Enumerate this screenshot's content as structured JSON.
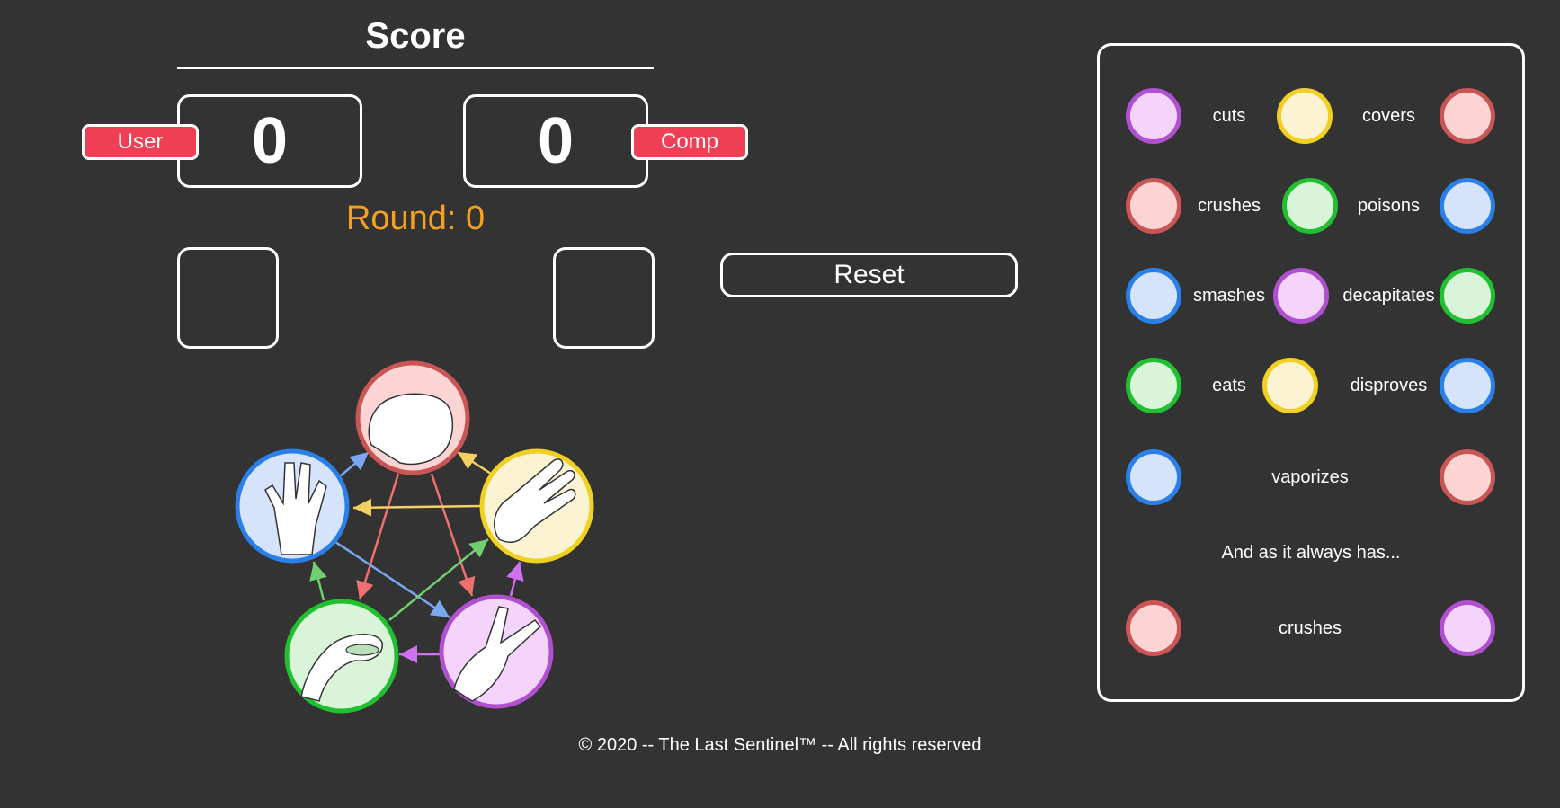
{
  "score": {
    "title": "Score",
    "user_value": "0",
    "comp_value": "0",
    "user_label": "User",
    "comp_label": "Comp",
    "round_text": "Round: 0"
  },
  "controls": {
    "reset_label": "Reset"
  },
  "colors": {
    "background": "#333333",
    "tag": "#ee3f55",
    "round": "#f5a020",
    "rock": "#c95555",
    "paper": "#f0d020",
    "scissors": "#b050d0",
    "lizard": "#20c030",
    "spock": "#2a7fe8"
  },
  "rules": [
    {
      "left": "scissors",
      "verb1": "cuts",
      "middle": "paper",
      "verb2": "covers",
      "right": "rock"
    },
    {
      "left": "rock",
      "verb1": "crushes",
      "middle": "lizard",
      "verb2": "poisons",
      "right": "spock"
    },
    {
      "left": "spock",
      "verb1": "smashes",
      "middle": "scissors",
      "verb2": "decapitates",
      "right": "lizard"
    },
    {
      "left": "lizard",
      "verb1": "eats",
      "middle": "paper",
      "verb2": "disproves",
      "right": "spock"
    }
  ],
  "rule5": {
    "left": "spock",
    "verb": "vaporizes",
    "right": "rock"
  },
  "always_text": "And as it always has...",
  "rule6": {
    "left": "rock",
    "verb": "crushes",
    "right": "scissors"
  },
  "footer": "© 2020 -- The Last Sentinel™ -- All rights reserved"
}
